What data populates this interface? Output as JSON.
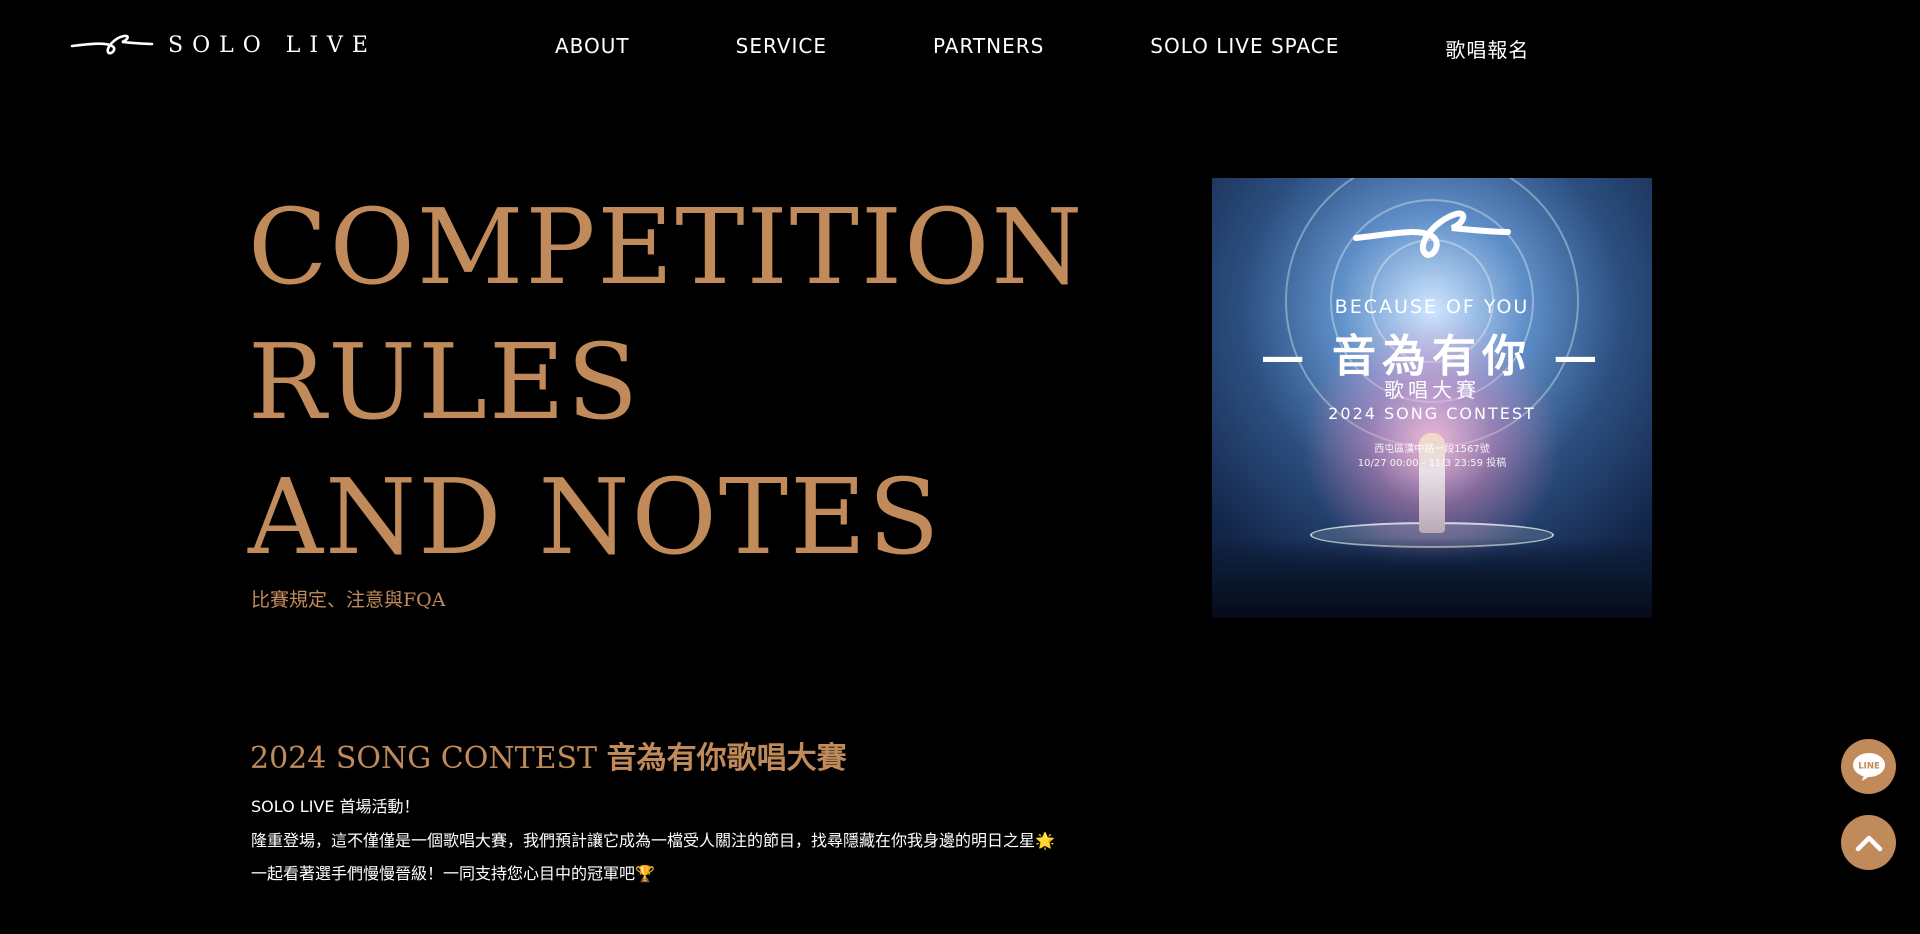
{
  "header": {
    "logo_text": "SOLO LIVE",
    "nav": [
      "ABOUT",
      "SERVICE",
      "PARTNERS",
      "SOLO LIVE SPACE",
      "歌唱報名"
    ]
  },
  "hero": {
    "title_lines": [
      "COMPETITION",
      "RULES",
      "AND NOTES"
    ],
    "subtitle": "比賽規定、注意與FQA"
  },
  "poster": {
    "english_title": "BECAUSE OF YOU",
    "chinese_title": "音為有你",
    "chinese_subtitle": "歌唱大賽",
    "contest_label": "2024 SONG CONTEST",
    "address": "西屯區漢中路一段1567號",
    "time": "10/27 00:00 - 11/3 23:59 投稿"
  },
  "contest": {
    "heading_en": "2024 SONG CONTEST",
    "heading_cn": "音為有你歌唱大賽",
    "lines": [
      "SOLO LIVE 首場活動！",
      "隆重登場，這不僅僅是一個歌唱大賽，我們預計讓它成為一檔受人關注的節目，找尋隱藏在你我身邊的明日之星🌟",
      "一起看著選手們慢慢晉級！一同支持您心目中的冠軍吧🏆"
    ]
  },
  "floating": {
    "line_label": "LINE",
    "accent_color": "#c08a5a",
    "icons": [
      "line-chat-icon",
      "chevron-up-icon"
    ]
  }
}
